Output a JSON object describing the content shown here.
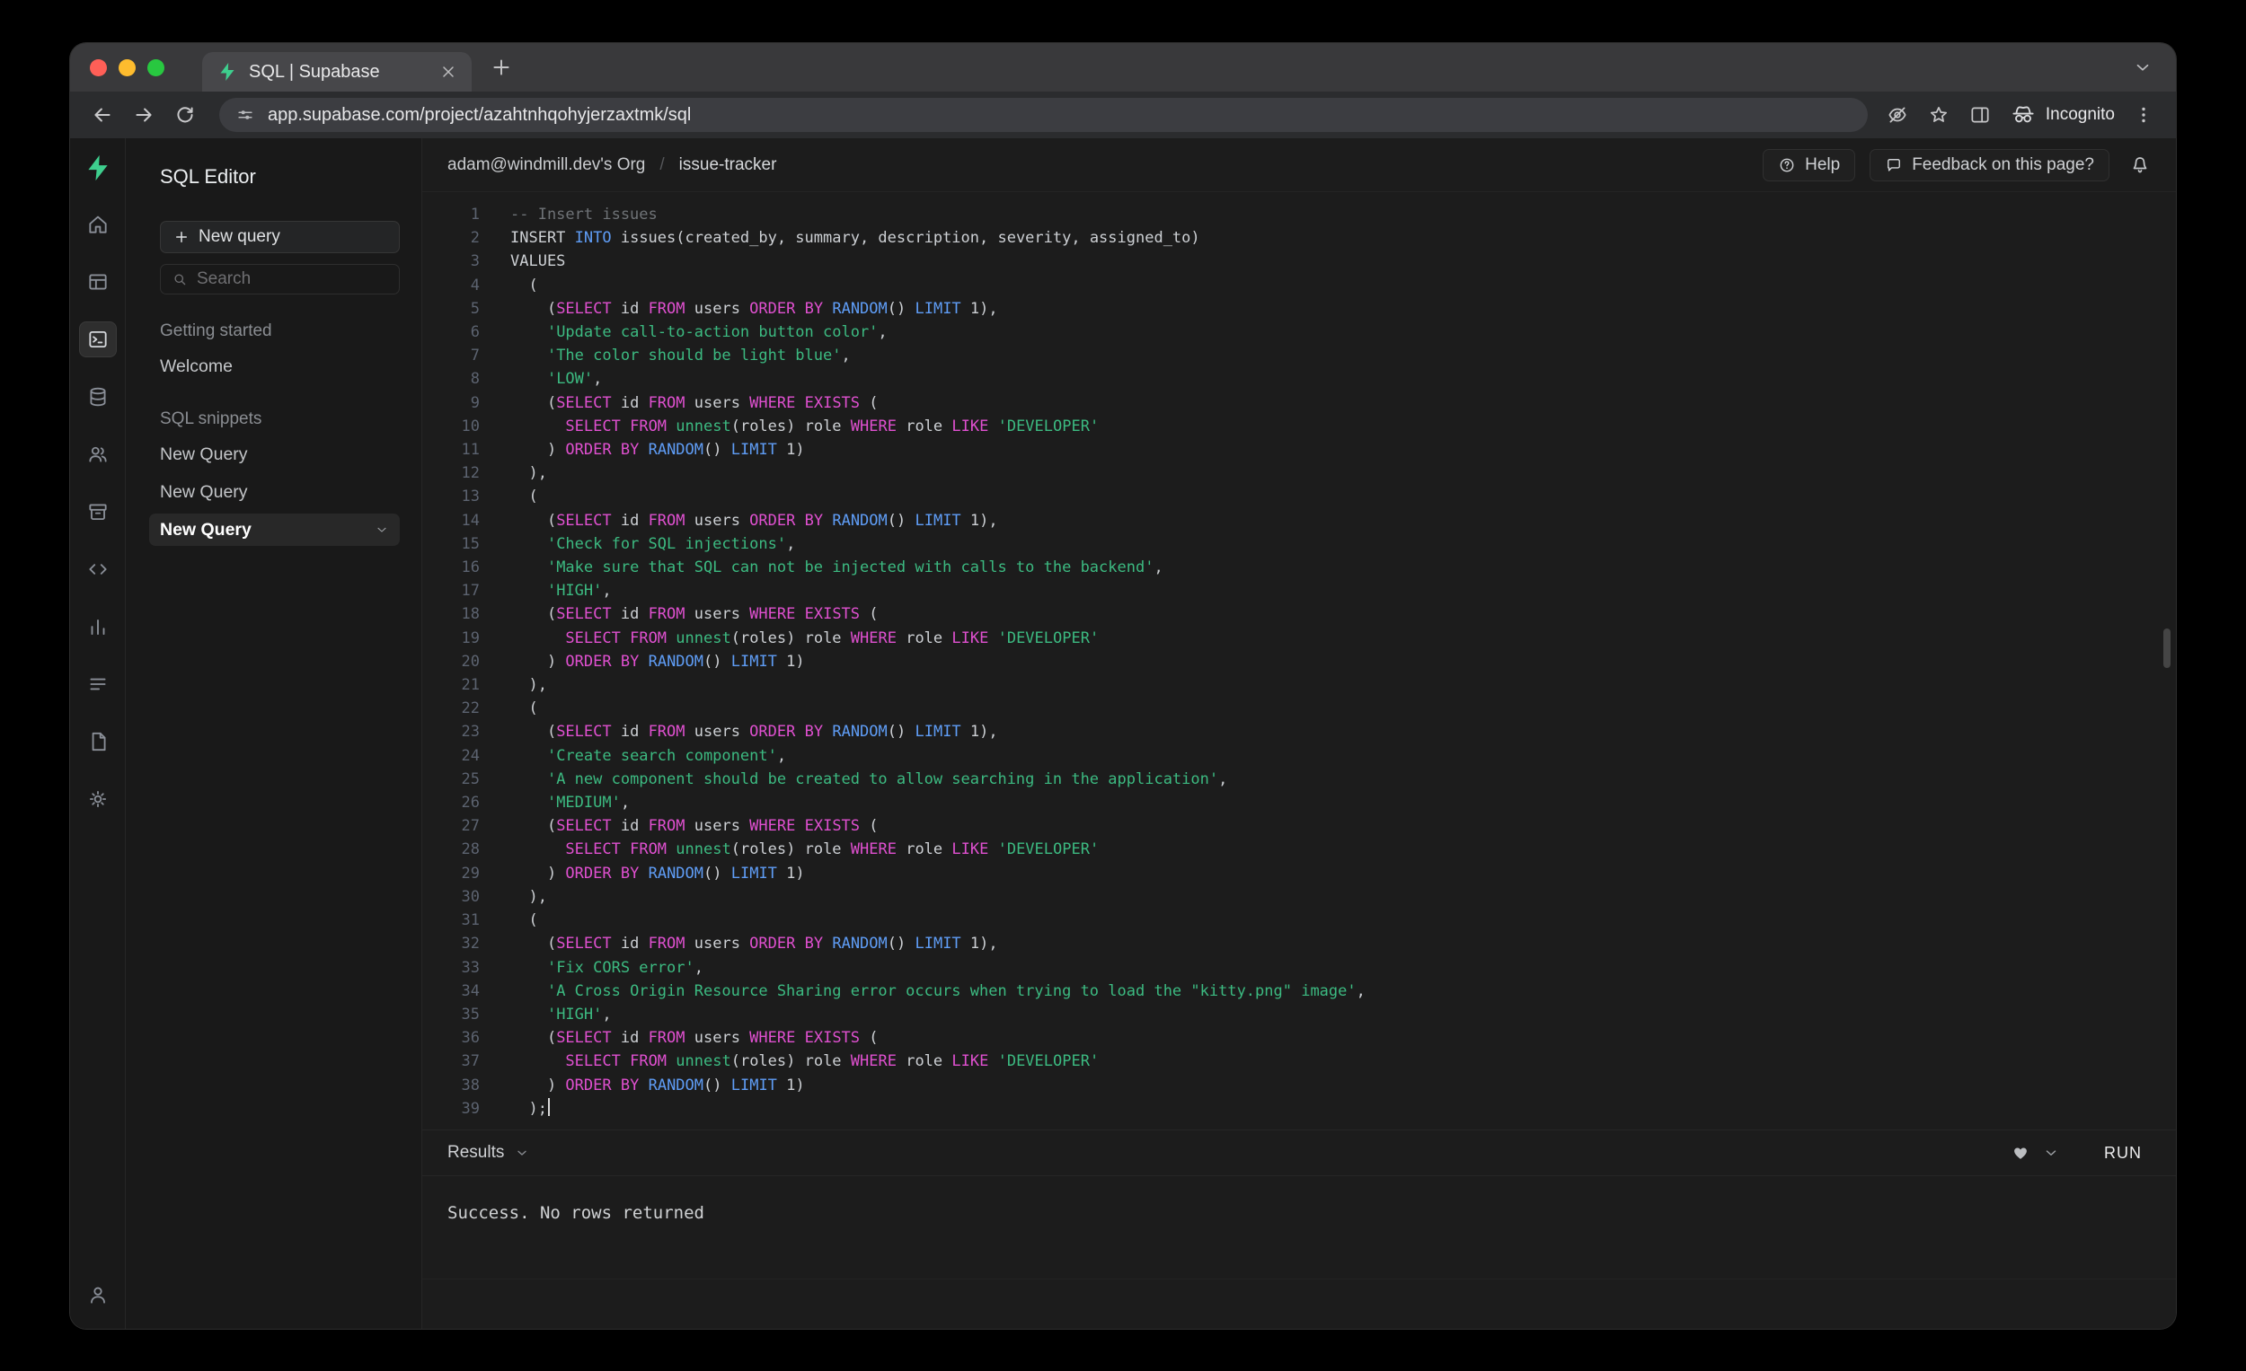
{
  "browser": {
    "tab_title": "SQL | Supabase",
    "url": "app.supabase.com/project/azahtnhqohyjerzaxtmk/sql",
    "incognito_label": "Incognito"
  },
  "rail": {
    "items": [
      {
        "icon": "home",
        "active": false
      },
      {
        "icon": "table-editor",
        "active": false
      },
      {
        "icon": "sql-editor",
        "active": true
      },
      {
        "icon": "database",
        "active": false
      },
      {
        "icon": "authentication",
        "active": false
      },
      {
        "icon": "storage",
        "active": false
      },
      {
        "icon": "code",
        "active": false
      },
      {
        "icon": "reports",
        "active": false
      },
      {
        "icon": "logs",
        "active": false
      },
      {
        "icon": "docs",
        "active": false
      },
      {
        "icon": "settings",
        "active": false
      }
    ],
    "bottom_icon": "account"
  },
  "sidebar": {
    "title": "SQL Editor",
    "new_query_label": "New query",
    "search_placeholder": "Search",
    "sections": [
      {
        "label": "Getting started",
        "items": [
          {
            "label": "Welcome",
            "active": false
          }
        ]
      },
      {
        "label": "SQL snippets",
        "items": [
          {
            "label": "New Query",
            "active": false
          },
          {
            "label": "New Query",
            "active": false
          },
          {
            "label": "New Query",
            "active": true
          }
        ]
      }
    ]
  },
  "header": {
    "breadcrumb_org": "adam@windmill.dev's Org",
    "breadcrumb_sep": "/",
    "breadcrumb_project": "issue-tracker",
    "help_label": "Help",
    "feedback_label": "Feedback on this page?"
  },
  "editor": {
    "lines": [
      [
        [
          "c",
          "-- Insert issues"
        ]
      ],
      [
        [
          "p",
          "INSERT "
        ],
        [
          "b",
          "INTO"
        ],
        [
          "p",
          " issues(created_by, summary, description, severity, assigned_to)"
        ]
      ],
      [
        [
          "p",
          "VALUES"
        ]
      ],
      [
        [
          "p",
          "  ("
        ]
      ],
      [
        [
          "p",
          "    ("
        ],
        [
          "k",
          "SELECT"
        ],
        [
          "p",
          " id "
        ],
        [
          "k",
          "FROM"
        ],
        [
          "p",
          " users "
        ],
        [
          "k",
          "ORDER"
        ],
        [
          "p",
          " "
        ],
        [
          "k",
          "BY"
        ],
        [
          "p",
          " "
        ],
        [
          "b",
          "RANDOM"
        ],
        [
          "p",
          "() "
        ],
        [
          "b",
          "LIMIT"
        ],
        [
          "p",
          " 1),"
        ]
      ],
      [
        [
          "p",
          "    "
        ],
        [
          "s",
          "'Update call-to-action button color'"
        ],
        [
          "p",
          ","
        ]
      ],
      [
        [
          "p",
          "    "
        ],
        [
          "s",
          "'The color should be light blue'"
        ],
        [
          "p",
          ","
        ]
      ],
      [
        [
          "p",
          "    "
        ],
        [
          "s",
          "'LOW'"
        ],
        [
          "p",
          ","
        ]
      ],
      [
        [
          "p",
          "    ("
        ],
        [
          "k",
          "SELECT"
        ],
        [
          "p",
          " id "
        ],
        [
          "k",
          "FROM"
        ],
        [
          "p",
          " users "
        ],
        [
          "k",
          "WHERE"
        ],
        [
          "p",
          " "
        ],
        [
          "k",
          "EXISTS"
        ],
        [
          "p",
          " ("
        ]
      ],
      [
        [
          "p",
          "      "
        ],
        [
          "k",
          "SELECT"
        ],
        [
          "p",
          " "
        ],
        [
          "k",
          "FROM"
        ],
        [
          "p",
          " "
        ],
        [
          "s",
          "unnest"
        ],
        [
          "p",
          "(roles) role "
        ],
        [
          "k",
          "WHERE"
        ],
        [
          "p",
          " role "
        ],
        [
          "k",
          "LIKE"
        ],
        [
          "p",
          " "
        ],
        [
          "s",
          "'DEVELOPER'"
        ]
      ],
      [
        [
          "p",
          "    ) "
        ],
        [
          "k",
          "ORDER"
        ],
        [
          "p",
          " "
        ],
        [
          "k",
          "BY"
        ],
        [
          "p",
          " "
        ],
        [
          "b",
          "RANDOM"
        ],
        [
          "p",
          "() "
        ],
        [
          "b",
          "LIMIT"
        ],
        [
          "p",
          " 1)"
        ]
      ],
      [
        [
          "p",
          "  ),"
        ]
      ],
      [
        [
          "p",
          "  ("
        ]
      ],
      [
        [
          "p",
          "    ("
        ],
        [
          "k",
          "SELECT"
        ],
        [
          "p",
          " id "
        ],
        [
          "k",
          "FROM"
        ],
        [
          "p",
          " users "
        ],
        [
          "k",
          "ORDER"
        ],
        [
          "p",
          " "
        ],
        [
          "k",
          "BY"
        ],
        [
          "p",
          " "
        ],
        [
          "b",
          "RANDOM"
        ],
        [
          "p",
          "() "
        ],
        [
          "b",
          "LIMIT"
        ],
        [
          "p",
          " 1),"
        ]
      ],
      [
        [
          "p",
          "    "
        ],
        [
          "s",
          "'Check for SQL injections'"
        ],
        [
          "p",
          ","
        ]
      ],
      [
        [
          "p",
          "    "
        ],
        [
          "s",
          "'Make sure that SQL can not be injected with calls to the backend'"
        ],
        [
          "p",
          ","
        ]
      ],
      [
        [
          "p",
          "    "
        ],
        [
          "s",
          "'HIGH'"
        ],
        [
          "p",
          ","
        ]
      ],
      [
        [
          "p",
          "    ("
        ],
        [
          "k",
          "SELECT"
        ],
        [
          "p",
          " id "
        ],
        [
          "k",
          "FROM"
        ],
        [
          "p",
          " users "
        ],
        [
          "k",
          "WHERE"
        ],
        [
          "p",
          " "
        ],
        [
          "k",
          "EXISTS"
        ],
        [
          "p",
          " ("
        ]
      ],
      [
        [
          "p",
          "      "
        ],
        [
          "k",
          "SELECT"
        ],
        [
          "p",
          " "
        ],
        [
          "k",
          "FROM"
        ],
        [
          "p",
          " "
        ],
        [
          "s",
          "unnest"
        ],
        [
          "p",
          "(roles) role "
        ],
        [
          "k",
          "WHERE"
        ],
        [
          "p",
          " role "
        ],
        [
          "k",
          "LIKE"
        ],
        [
          "p",
          " "
        ],
        [
          "s",
          "'DEVELOPER'"
        ]
      ],
      [
        [
          "p",
          "    ) "
        ],
        [
          "k",
          "ORDER"
        ],
        [
          "p",
          " "
        ],
        [
          "k",
          "BY"
        ],
        [
          "p",
          " "
        ],
        [
          "b",
          "RANDOM"
        ],
        [
          "p",
          "() "
        ],
        [
          "b",
          "LIMIT"
        ],
        [
          "p",
          " 1)"
        ]
      ],
      [
        [
          "p",
          "  ),"
        ]
      ],
      [
        [
          "p",
          "  ("
        ]
      ],
      [
        [
          "p",
          "    ("
        ],
        [
          "k",
          "SELECT"
        ],
        [
          "p",
          " id "
        ],
        [
          "k",
          "FROM"
        ],
        [
          "p",
          " users "
        ],
        [
          "k",
          "ORDER"
        ],
        [
          "p",
          " "
        ],
        [
          "k",
          "BY"
        ],
        [
          "p",
          " "
        ],
        [
          "b",
          "RANDOM"
        ],
        [
          "p",
          "() "
        ],
        [
          "b",
          "LIMIT"
        ],
        [
          "p",
          " 1),"
        ]
      ],
      [
        [
          "p",
          "    "
        ],
        [
          "s",
          "'Create search component'"
        ],
        [
          "p",
          ","
        ]
      ],
      [
        [
          "p",
          "    "
        ],
        [
          "s",
          "'A new component should be created to allow searching in the application'"
        ],
        [
          "p",
          ","
        ]
      ],
      [
        [
          "p",
          "    "
        ],
        [
          "s",
          "'MEDIUM'"
        ],
        [
          "p",
          ","
        ]
      ],
      [
        [
          "p",
          "    ("
        ],
        [
          "k",
          "SELECT"
        ],
        [
          "p",
          " id "
        ],
        [
          "k",
          "FROM"
        ],
        [
          "p",
          " users "
        ],
        [
          "k",
          "WHERE"
        ],
        [
          "p",
          " "
        ],
        [
          "k",
          "EXISTS"
        ],
        [
          "p",
          " ("
        ]
      ],
      [
        [
          "p",
          "      "
        ],
        [
          "k",
          "SELECT"
        ],
        [
          "p",
          " "
        ],
        [
          "k",
          "FROM"
        ],
        [
          "p",
          " "
        ],
        [
          "s",
          "unnest"
        ],
        [
          "p",
          "(roles) role "
        ],
        [
          "k",
          "WHERE"
        ],
        [
          "p",
          " role "
        ],
        [
          "k",
          "LIKE"
        ],
        [
          "p",
          " "
        ],
        [
          "s",
          "'DEVELOPER'"
        ]
      ],
      [
        [
          "p",
          "    ) "
        ],
        [
          "k",
          "ORDER"
        ],
        [
          "p",
          " "
        ],
        [
          "k",
          "BY"
        ],
        [
          "p",
          " "
        ],
        [
          "b",
          "RANDOM"
        ],
        [
          "p",
          "() "
        ],
        [
          "b",
          "LIMIT"
        ],
        [
          "p",
          " 1)"
        ]
      ],
      [
        [
          "p",
          "  ),"
        ]
      ],
      [
        [
          "p",
          "  ("
        ]
      ],
      [
        [
          "p",
          "    ("
        ],
        [
          "k",
          "SELECT"
        ],
        [
          "p",
          " id "
        ],
        [
          "k",
          "FROM"
        ],
        [
          "p",
          " users "
        ],
        [
          "k",
          "ORDER"
        ],
        [
          "p",
          " "
        ],
        [
          "k",
          "BY"
        ],
        [
          "p",
          " "
        ],
        [
          "b",
          "RANDOM"
        ],
        [
          "p",
          "() "
        ],
        [
          "b",
          "LIMIT"
        ],
        [
          "p",
          " 1),"
        ]
      ],
      [
        [
          "p",
          "    "
        ],
        [
          "s",
          "'Fix CORS error'"
        ],
        [
          "p",
          ","
        ]
      ],
      [
        [
          "p",
          "    "
        ],
        [
          "s",
          "'A Cross Origin Resource Sharing error occurs when trying to load the \"kitty.png\" image'"
        ],
        [
          "p",
          ","
        ]
      ],
      [
        [
          "p",
          "    "
        ],
        [
          "s",
          "'HIGH'"
        ],
        [
          "p",
          ","
        ]
      ],
      [
        [
          "p",
          "    ("
        ],
        [
          "k",
          "SELECT"
        ],
        [
          "p",
          " id "
        ],
        [
          "k",
          "FROM"
        ],
        [
          "p",
          " users "
        ],
        [
          "k",
          "WHERE"
        ],
        [
          "p",
          " "
        ],
        [
          "k",
          "EXISTS"
        ],
        [
          "p",
          " ("
        ]
      ],
      [
        [
          "p",
          "      "
        ],
        [
          "k",
          "SELECT"
        ],
        [
          "p",
          " "
        ],
        [
          "k",
          "FROM"
        ],
        [
          "p",
          " "
        ],
        [
          "s",
          "unnest"
        ],
        [
          "p",
          "(roles) role "
        ],
        [
          "k",
          "WHERE"
        ],
        [
          "p",
          " role "
        ],
        [
          "k",
          "LIKE"
        ],
        [
          "p",
          " "
        ],
        [
          "s",
          "'DEVELOPER'"
        ]
      ],
      [
        [
          "p",
          "    ) "
        ],
        [
          "k",
          "ORDER"
        ],
        [
          "p",
          " "
        ],
        [
          "k",
          "BY"
        ],
        [
          "p",
          " "
        ],
        [
          "b",
          "RANDOM"
        ],
        [
          "p",
          "() "
        ],
        [
          "b",
          "LIMIT"
        ],
        [
          "p",
          " 1)"
        ]
      ],
      [
        [
          "p",
          "  );"
        ],
        [
          "cur",
          ""
        ]
      ]
    ]
  },
  "results": {
    "label": "Results",
    "run_label": "RUN",
    "message": "Success. No rows returned"
  },
  "colors": {
    "plain": "#cdd0d4",
    "keyword": "#e050d0",
    "blue": "#5f9df6",
    "string": "#3cba81",
    "comment": "#6f7377",
    "accent": "#3ecf8e",
    "linenum": "#5c6370"
  }
}
